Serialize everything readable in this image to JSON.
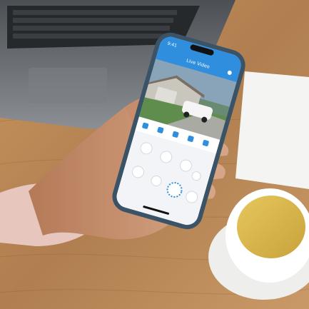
{
  "phone": {
    "status_time": "9:41",
    "app_title": "Live Video"
  },
  "colors": {
    "wood": "#b8875a",
    "laptop": "#6f7378",
    "app_blue": "#2f8fde",
    "tea": "#d8b84a"
  },
  "icons": {
    "toolbar": [
      "chevron-icon",
      "share-icon",
      "camera-icon",
      "calendar-icon",
      "gear-icon"
    ],
    "controls": [
      "mute-icon",
      "pan-icon",
      "light-icon",
      "speaker-icon",
      "record-icon",
      "snapshot-icon",
      "microphone-icon",
      "siren-icon"
    ]
  }
}
